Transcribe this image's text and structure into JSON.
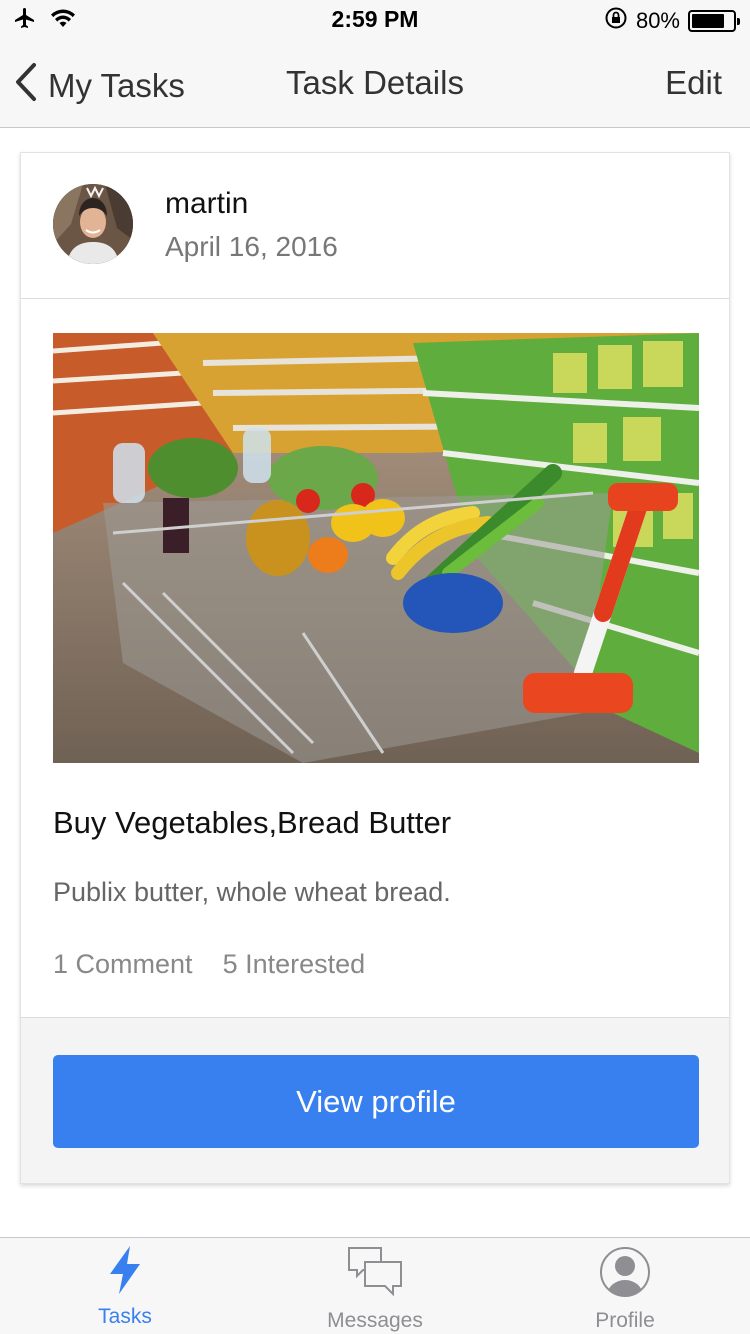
{
  "status_bar": {
    "time": "2:59 PM",
    "battery_percent": "80%",
    "battery_level": 0.8,
    "icons": [
      "airplane-icon",
      "wifi-icon",
      "rotation-lock-icon",
      "battery-icon"
    ]
  },
  "nav": {
    "back_label": "My Tasks",
    "title": "Task Details",
    "edit_label": "Edit"
  },
  "post": {
    "user_name": "martin",
    "date": "April 16, 2016",
    "title": "Buy Vegetables,Bread Butter",
    "description": "Publix butter, whole wheat bread.",
    "comments": "1 Comment",
    "interested": "5 Interested",
    "button_label": "View profile"
  },
  "tabs": [
    {
      "label": "Tasks",
      "icon": "lightning-icon",
      "active": true
    },
    {
      "label": "Messages",
      "icon": "chat-bubbles-icon",
      "active": false
    },
    {
      "label": "Profile",
      "icon": "profile-icon",
      "active": false
    }
  ],
  "colors": {
    "accent": "#3880f0",
    "tab_active": "#3880f0",
    "tab_inactive": "#8e8e93"
  }
}
